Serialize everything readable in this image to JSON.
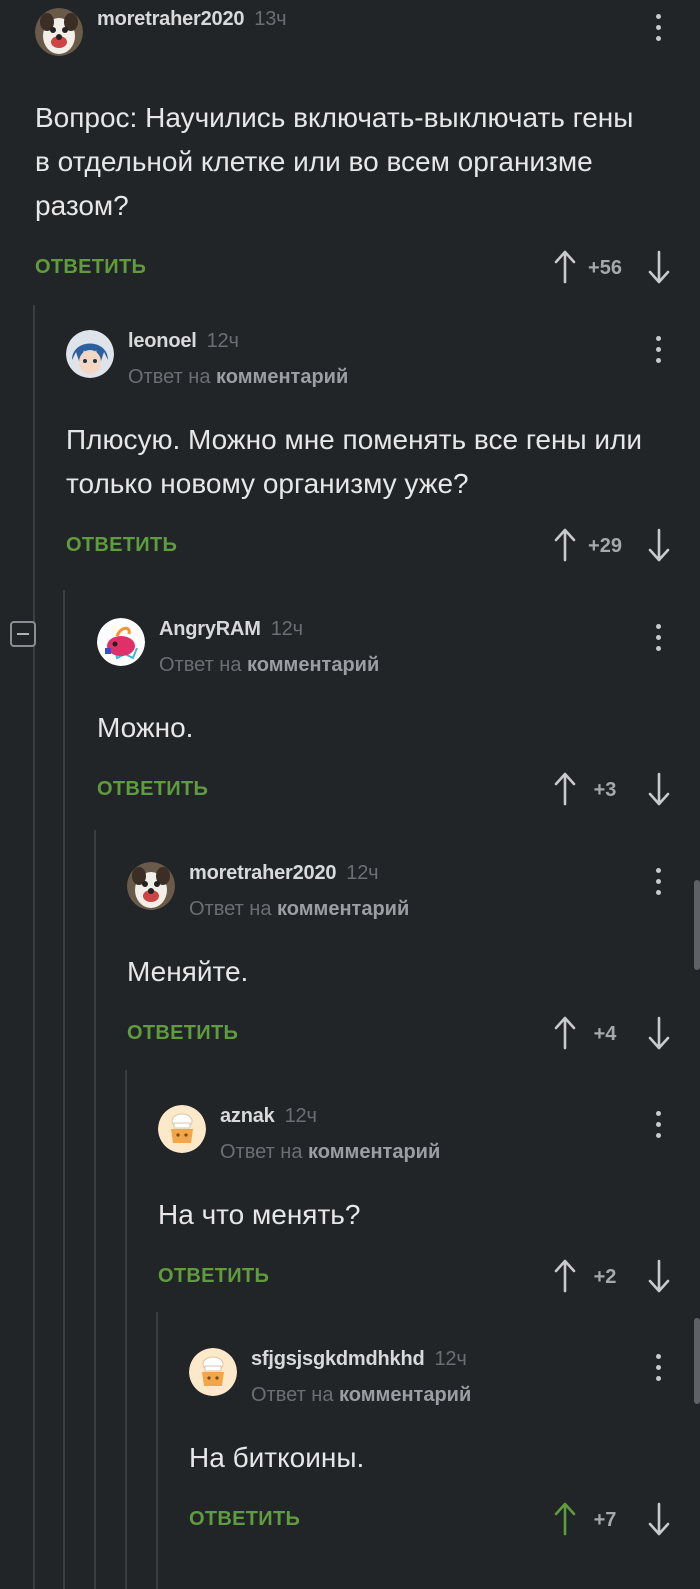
{
  "reply_label": "ОТВЕТИТЬ",
  "reply_to_prefix": "Ответ на",
  "reply_to_target": "комментарий",
  "colors": {
    "background": "#222528",
    "accent_green": "#5f9c3d",
    "upvoted": "#5f9c3d"
  },
  "comments": [
    {
      "username": "moretraher2020",
      "time": "13ч",
      "text": "Вопрос: Научились включать-выключать гены в отдельной клетке или во всем организме разом?",
      "rating": "+56",
      "avatar": "dog-avatar"
    },
    {
      "username": "leonoel",
      "time": "12ч",
      "text": "Плюсую. Можно мне поменять все гены или только новому организму уже?",
      "rating": "+29",
      "avatar": "anime-avatar"
    },
    {
      "username": "AngryRAM",
      "time": "12ч",
      "text": "Можно.",
      "rating": "+3",
      "avatar": "ram-avatar"
    },
    {
      "username": "moretraher2020",
      "time": "12ч",
      "text": "Меняйте.",
      "rating": "+4",
      "avatar": "dog-avatar"
    },
    {
      "username": "aznak",
      "time": "12ч",
      "text": "На что менять?",
      "rating": "+2",
      "avatar": "chef-avatar"
    },
    {
      "username": "sfjgsjsgkdmdhkhd",
      "time": "12ч",
      "text": "На биткоины.",
      "rating": "+7",
      "avatar": "chef-avatar",
      "upvoted": true
    }
  ]
}
